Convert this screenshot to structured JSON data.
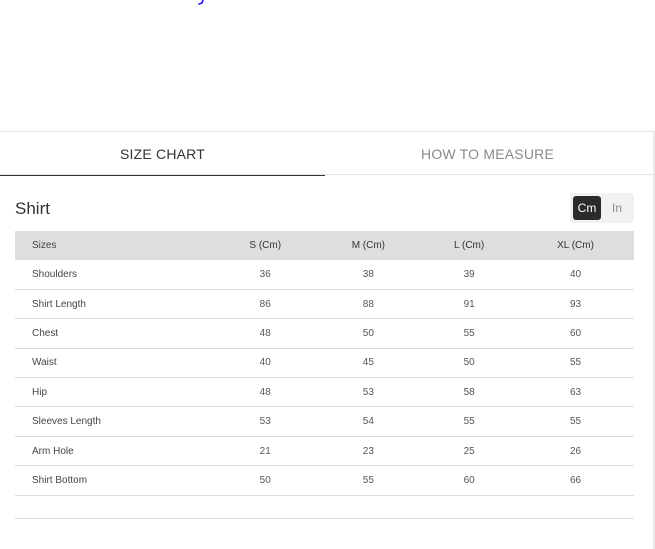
{
  "tabs": [
    {
      "label": "SIZE CHART",
      "active": true
    },
    {
      "label": "HOW TO MEASURE",
      "active": false
    }
  ],
  "section": {
    "title": "Shirt",
    "units": [
      {
        "label": "Cm",
        "active": true
      },
      {
        "label": "In",
        "active": false
      }
    ]
  },
  "table": {
    "headers": [
      "Sizes",
      "S (Cm)",
      "M (Cm)",
      "L (Cm)",
      "XL (Cm)"
    ],
    "rows": [
      [
        "Shoulders",
        "36",
        "38",
        "39",
        "40"
      ],
      [
        "Shirt Length",
        "86",
        "88",
        "91",
        "93"
      ],
      [
        "Chest",
        "48",
        "50",
        "55",
        "60"
      ],
      [
        "Waist",
        "40",
        "45",
        "50",
        "55"
      ],
      [
        "Hip",
        "48",
        "53",
        "58",
        "63"
      ],
      [
        "Sleeves Length",
        "53",
        "54",
        "55",
        "55"
      ],
      [
        "Arm Hole",
        "21",
        "23",
        "25",
        "26"
      ],
      [
        "Shirt Bottom",
        "50",
        "55",
        "60",
        "66"
      ]
    ]
  },
  "colors": {
    "accent_mark": "#1a1aff",
    "header_bg": "#dedede",
    "toggle_active": "#2b2b2b"
  }
}
